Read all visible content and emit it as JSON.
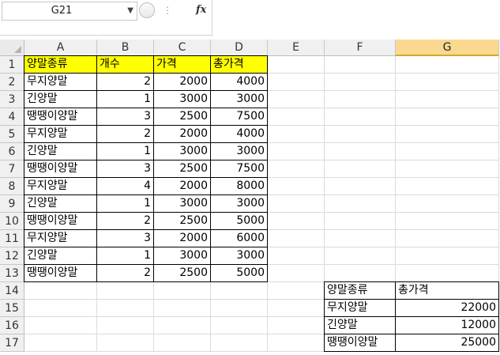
{
  "formula_bar": {
    "name_box": "G21",
    "dropdown_glyph": "▼",
    "dots": "⋮",
    "fx_label": "fx",
    "formula": ""
  },
  "columns": [
    "A",
    "B",
    "C",
    "D",
    "E",
    "F",
    "G"
  ],
  "selected_column": "G",
  "rows": [
    "1",
    "2",
    "3",
    "4",
    "5",
    "6",
    "7",
    "8",
    "9",
    "10",
    "11",
    "12",
    "13",
    "14",
    "15",
    "16",
    "17"
  ],
  "cells": {
    "A1": "양말종류",
    "B1": "개수",
    "C1": "가격",
    "D1": "총가격",
    "A2": "무지양말",
    "B2": "2",
    "C2": "2000",
    "D2": "4000",
    "A3": "긴양말",
    "B3": "1",
    "C3": "3000",
    "D3": "3000",
    "A4": "땡땡이양말",
    "B4": "3",
    "C4": "2500",
    "D4": "7500",
    "A5": "무지양말",
    "B5": "2",
    "C5": "2000",
    "D5": "4000",
    "A6": "긴양말",
    "B6": "1",
    "C6": "3000",
    "D6": "3000",
    "A7": "땡땡이양말",
    "B7": "3",
    "C7": "2500",
    "D7": "7500",
    "A8": "무지양말",
    "B8": "4",
    "C8": "2000",
    "D8": "8000",
    "A9": "긴양말",
    "B9": "1",
    "C9": "3000",
    "D9": "3000",
    "A10": "땡땡이양말",
    "B10": "2",
    "C10": "2500",
    "D10": "5000",
    "A11": "무지양말",
    "B11": "3",
    "C11": "2000",
    "D11": "6000",
    "A12": "긴양말",
    "B12": "1",
    "C12": "3000",
    "D12": "3000",
    "A13": "땡땡이양말",
    "B13": "2",
    "C13": "2500",
    "D13": "5000",
    "F14": "양말종류",
    "G14": "총가격",
    "F15": "무지양말",
    "G15": "22000",
    "F16": "긴양말",
    "G16": "12000",
    "F17": "땡땡이양말",
    "G17": "25000"
  },
  "numeric_cells": [
    "B2",
    "C2",
    "D2",
    "B3",
    "C3",
    "D3",
    "B4",
    "C4",
    "D4",
    "B5",
    "C5",
    "D5",
    "B6",
    "C6",
    "D6",
    "B7",
    "C7",
    "D7",
    "B8",
    "C8",
    "D8",
    "B9",
    "C9",
    "D9",
    "B10",
    "C10",
    "D10",
    "B11",
    "C11",
    "D11",
    "B12",
    "C12",
    "D12",
    "B13",
    "C13",
    "D13",
    "G15",
    "G16",
    "G17"
  ],
  "highlighted_cells": [
    "A1",
    "B1",
    "C1",
    "D1"
  ],
  "bordered_cells": [
    "A1",
    "B1",
    "C1",
    "D1",
    "A2",
    "B2",
    "C2",
    "D2",
    "A3",
    "B3",
    "C3",
    "D3",
    "A4",
    "B4",
    "C4",
    "D4",
    "A5",
    "B5",
    "C5",
    "D5",
    "A6",
    "B6",
    "C6",
    "D6",
    "A7",
    "B7",
    "C7",
    "D7",
    "A8",
    "B8",
    "C8",
    "D8",
    "A9",
    "B9",
    "C9",
    "D9",
    "A10",
    "B10",
    "C10",
    "D10",
    "A11",
    "B11",
    "C11",
    "D11",
    "A12",
    "B12",
    "C12",
    "D12",
    "A13",
    "B13",
    "C13",
    "D13",
    "F14",
    "G14",
    "F15",
    "G15",
    "F16",
    "G16",
    "F17",
    "G17"
  ],
  "colors": {
    "highlight": "#ffff00",
    "selected_header": "#f8d98f",
    "selected_header_border": "#d9a62a"
  }
}
